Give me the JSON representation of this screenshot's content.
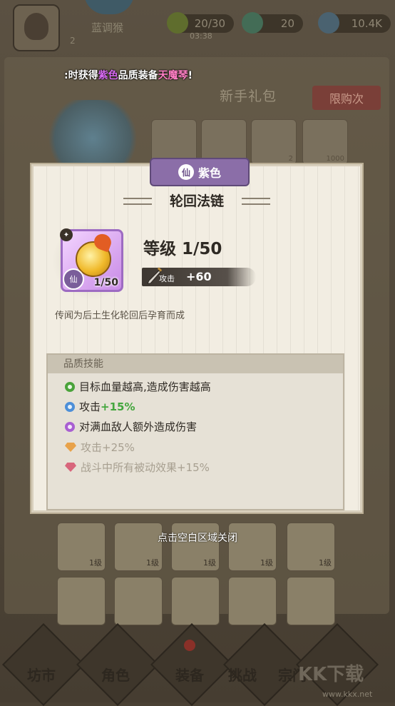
{
  "topbar": {
    "player_name": "蓝调猴",
    "player_level": "2",
    "energy": "20/30",
    "timer": "03:38",
    "gems": "20",
    "coins": "10.4K"
  },
  "notice": {
    "prefix": ":时获得",
    "quality": "紫色",
    "middle": "品质装备",
    "item": "天魔琴",
    "suffix": "!"
  },
  "background": {
    "shop_title": "新手礼包",
    "limit_button": "限购次",
    "slot_counts": [
      "2",
      "1000"
    ],
    "grid_levels": [
      "1级",
      "1级",
      "1级",
      "1级",
      "1级"
    ],
    "nav_labels": [
      "坊市",
      "角色",
      "装备",
      "挑战",
      "宗门"
    ],
    "watermark": "KK下载",
    "watermark_url": "www.kkx.net"
  },
  "modal": {
    "quality_label": "紫色",
    "quality_icon": "仙",
    "item_name": "轮回法链",
    "item_level_badge": "1/50",
    "level_text": "等级 1/50",
    "attack_label": "攻击",
    "attack_value": "+60",
    "description": "传闻为后土生化轮回后孕育而成",
    "skills_title": "品质技能",
    "skills": [
      {
        "icon": "green-ring",
        "text": "目标血量越高,造成伤害越高",
        "bonus": "",
        "active": true
      },
      {
        "icon": "blue-ring",
        "text": "攻击",
        "bonus": "+15%",
        "active": true
      },
      {
        "icon": "purple-ring",
        "text": "对满血敌人额外造成伤害",
        "bonus": "",
        "active": true
      },
      {
        "icon": "orange-gem",
        "text": "攻击",
        "bonus": "+25%",
        "active": false
      },
      {
        "icon": "red-gem",
        "text": "战斗中所有被动效果",
        "bonus": "+15%",
        "active": false
      }
    ]
  },
  "close_hint": "点击空白区域关闭",
  "colors": {
    "quality_purple": "#8b6ea8",
    "bonus_green": "#43a63d",
    "notice_purple": "#d86bf2",
    "notice_pink": "#ff7fc4"
  }
}
